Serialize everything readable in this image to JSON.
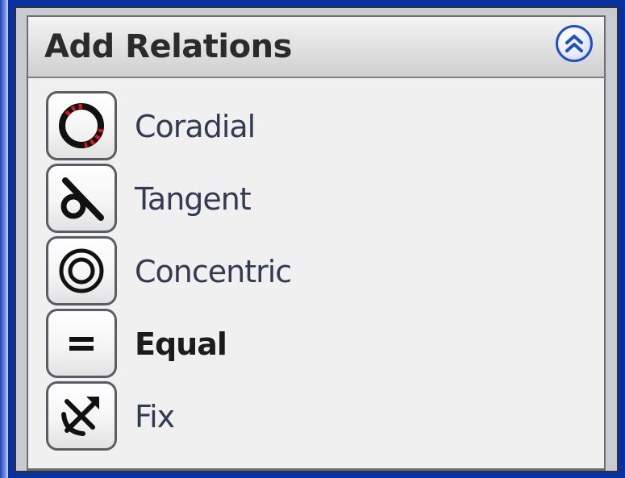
{
  "panel": {
    "title": "Add Relations",
    "collapse_icon": "double-chevron-up-icon",
    "accent": "#1f4fc4"
  },
  "relations": [
    {
      "label": "Coradial",
      "icon": "coradial-icon",
      "bold": false
    },
    {
      "label": "Tangent",
      "icon": "tangent-icon",
      "bold": false
    },
    {
      "label": "Concentric",
      "icon": "concentric-icon",
      "bold": false
    },
    {
      "label": "Equal",
      "icon": "equal-icon",
      "bold": true
    },
    {
      "label": "Fix",
      "icon": "fix-anchor-icon",
      "bold": false
    }
  ]
}
